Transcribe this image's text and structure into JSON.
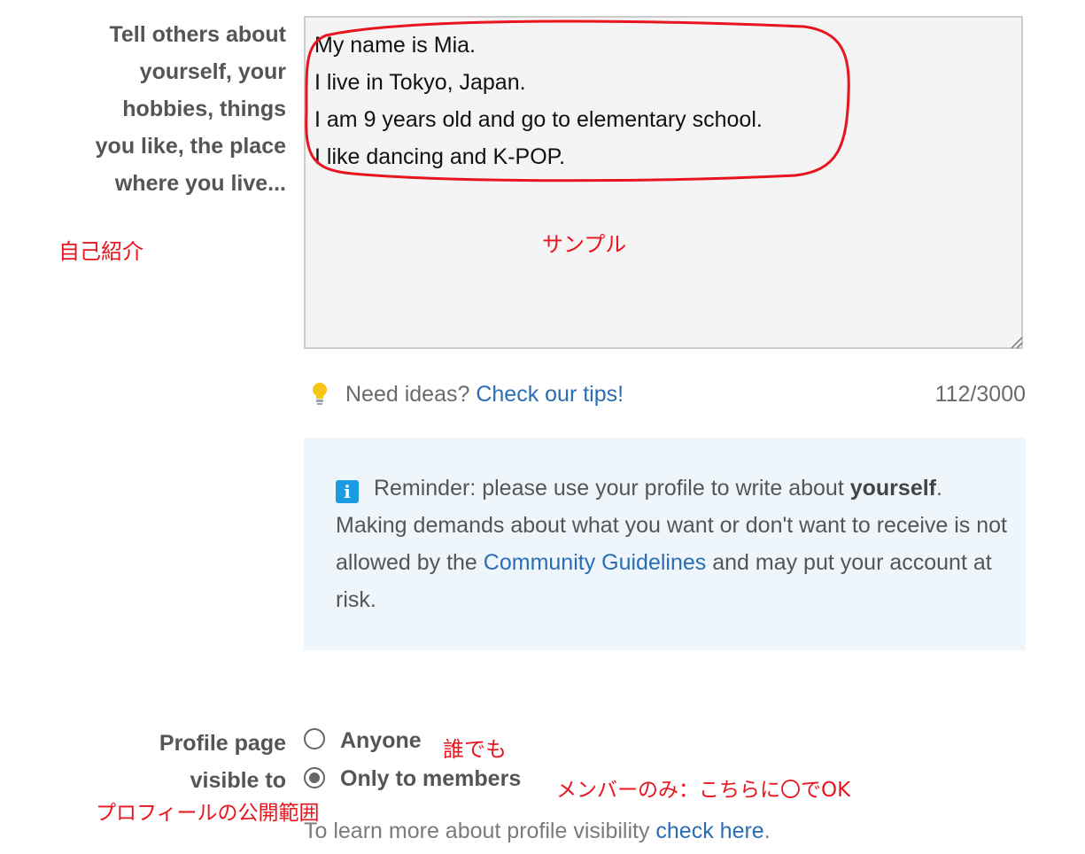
{
  "about": {
    "label_lines": [
      "Tell others about",
      "yourself, your",
      "hobbies, things",
      "you like, the place",
      "where you live..."
    ],
    "annotation": "自己紹介",
    "textarea_lines": [
      "My name is Mia.",
      "I live in Tokyo, Japan.",
      "I am 9 years old and go to elementary school.",
      "I like dancing and K-POP."
    ],
    "sample_annotation": "サンプル",
    "highlight_color": "#e8141e"
  },
  "tips": {
    "icon": "lightbulb-icon",
    "prefix": "Need ideas? ",
    "link": "Check our tips!",
    "char_count": "112/3000"
  },
  "reminder": {
    "icon": "info-icon",
    "icon_glyph": "i",
    "text_before": " Reminder: please use your profile to write about ",
    "bold": "yourself",
    "text_middle": ". Making demands about what you want or don't want to receive is not allowed by the ",
    "link": "Community Guidelines",
    "text_after": " and may put your account at risk.",
    "background": "#eef6fc"
  },
  "visibility": {
    "label_lines": [
      "Profile page",
      "visible to"
    ],
    "options": [
      {
        "label": "Anyone",
        "selected": false,
        "annotation": "誰でも"
      },
      {
        "label": "Only to members",
        "selected": true,
        "annotation": "メンバーのみ：こちらに〇でOK"
      }
    ],
    "label_annotation": "プロフィールの公開範囲",
    "learn_prefix": "To learn more about profile visibility ",
    "learn_link": "check here",
    "learn_suffix": "."
  },
  "colors": {
    "link": "#2a6db5",
    "annotation_red": "#e8141e",
    "info_blue": "#1b9be0"
  }
}
